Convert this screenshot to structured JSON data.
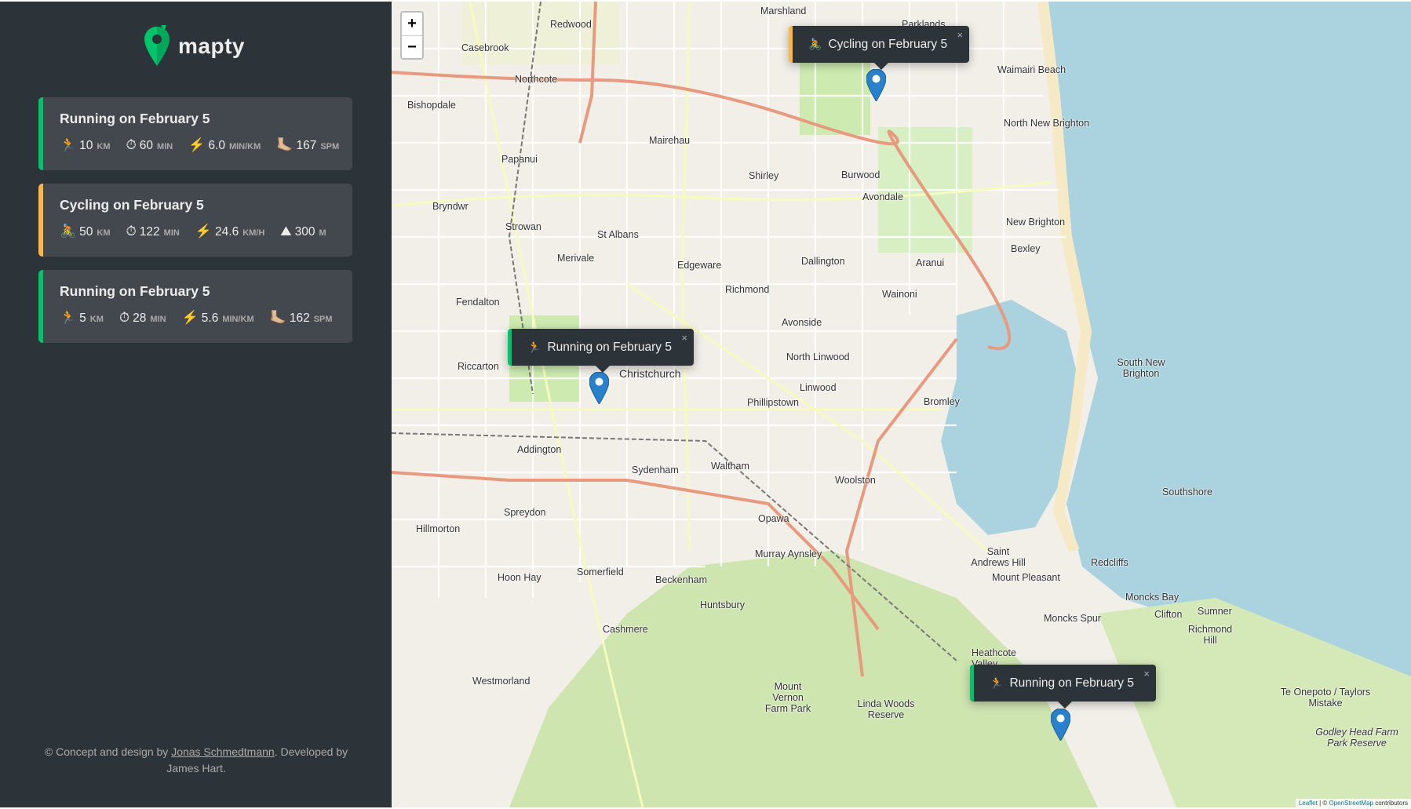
{
  "app": {
    "name": "mapty"
  },
  "workouts": [
    {
      "type": "running",
      "title": "Running on February 5",
      "details": [
        {
          "icon": "🏃",
          "value": "10",
          "unit": "KM"
        },
        {
          "icon": "⏱",
          "value": "60",
          "unit": "MIN"
        },
        {
          "icon": "⚡️",
          "value": "6.0",
          "unit": "MIN/KM"
        },
        {
          "icon": "🦶🏼",
          "value": "167",
          "unit": "SPM"
        }
      ]
    },
    {
      "type": "cycling",
      "title": "Cycling on February 5",
      "details": [
        {
          "icon": "🚴",
          "value": "50",
          "unit": "KM"
        },
        {
          "icon": "⏱",
          "value": "122",
          "unit": "MIN"
        },
        {
          "icon": "⚡️",
          "value": "24.6",
          "unit": "KM/H"
        },
        {
          "icon": "⛰",
          "value": "300",
          "unit": "M"
        }
      ]
    },
    {
      "type": "running",
      "title": "Running on February 5",
      "details": [
        {
          "icon": "🏃",
          "value": "5",
          "unit": "KM"
        },
        {
          "icon": "⏱",
          "value": "28",
          "unit": "MIN"
        },
        {
          "icon": "⚡️",
          "value": "5.6",
          "unit": "MIN/KM"
        },
        {
          "icon": "🦶🏼",
          "value": "162",
          "unit": "SPM"
        }
      ]
    }
  ],
  "footer": {
    "prefix": "© Concept and design by",
    "author_link": "Jonas Schmedtmann",
    "suffix": ". Developed by James Hart."
  },
  "map": {
    "zoom_in": "+",
    "zoom_out": "−",
    "popups": [
      {
        "type": "cycling",
        "icon": "🚴",
        "text": "Cycling on February 5",
        "close": "×"
      },
      {
        "type": "running",
        "icon": "🏃",
        "text": "Running on February 5",
        "close": "×"
      },
      {
        "type": "running",
        "icon": "🏃",
        "text": "Running on February 5",
        "close": "×"
      }
    ],
    "place_labels": [
      "Marshland",
      "Redwood",
      "Parklands",
      "Casebrook",
      "Northcote",
      "Waimairi Beach",
      "Bishopdale",
      "Mairehau",
      "North New Brighton",
      "Papanui",
      "Shirley",
      "Burwood",
      "Avondale",
      "Bryndwr",
      "Strowan",
      "St Albans",
      "New Brighton",
      "Merivale",
      "Edgeware",
      "Dallington",
      "Aranui",
      "Bexley",
      "Richmond",
      "Wainoni",
      "Fendalton",
      "Avonside",
      "North Linwood",
      "Riccarton",
      "Christchurch",
      "Linwood",
      "South New Brighton",
      "Phillipstown",
      "Bromley",
      "Addington",
      "Sydenham",
      "Waltham",
      "Woolston",
      "Southshore",
      "Spreydon",
      "Hillmorton",
      "Opawa",
      "Murray Aynsley",
      "Saint Andrews Hill",
      "Redcliffs",
      "Hoon Hay",
      "Somerfield",
      "Mount Pleasant",
      "Beckenham",
      "Huntsbury",
      "Moncks Bay",
      "Moncks Spur",
      "Clifton",
      "Sumner",
      "Cashmere",
      "Richmond Hill",
      "Heathcote Valley",
      "Westmorland",
      "Te Onepoto / Taylors Mistake",
      "Mount Vernon Farm Park",
      "Linda Woods Reserve",
      "Godley Head Farm Park Reserve"
    ],
    "attribution": {
      "leaflet": "Leaflet",
      "sep": " | © ",
      "osm": "OpenStreetMap",
      "suffix": " contributors"
    }
  }
}
